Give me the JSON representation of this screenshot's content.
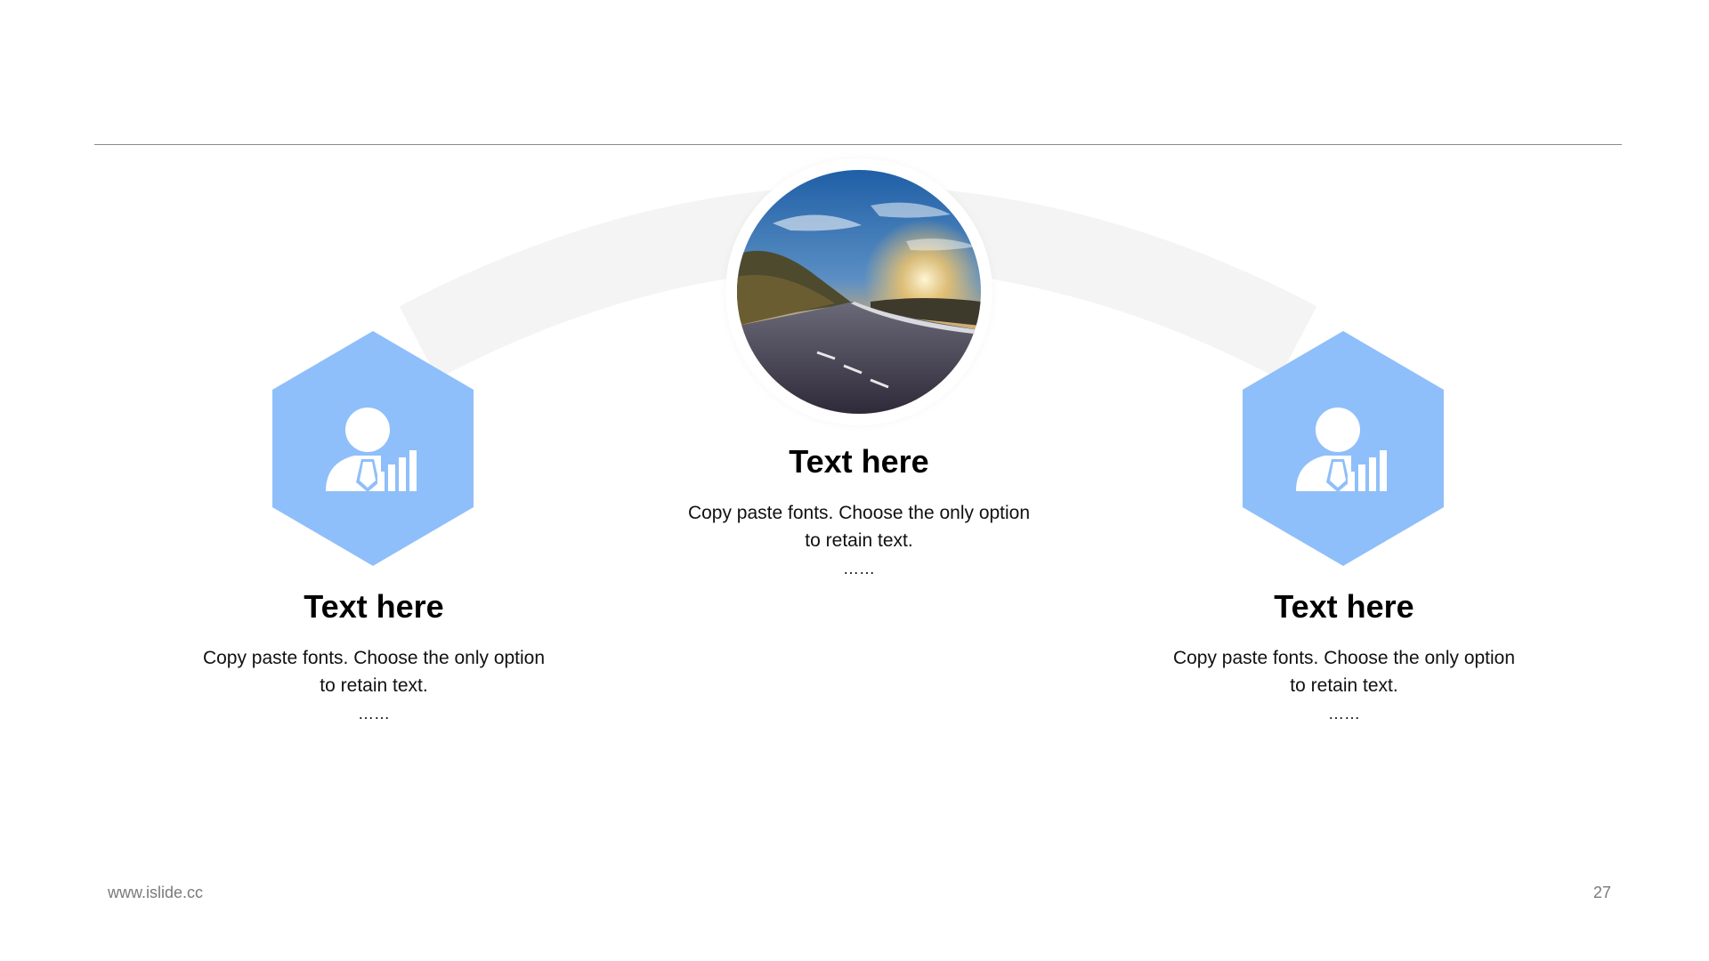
{
  "slide": {
    "accent_color": "#8fbffa",
    "arc_color": "#f4f4f4",
    "items": [
      {
        "heading": "Text here",
        "body_line1": "Copy paste fonts. Choose the only option",
        "body_line2": "to retain text.",
        "ellipsis": "……",
        "icon": "businessman-chart-icon"
      },
      {
        "heading": "Text here",
        "body_line1": "Copy paste fonts. Choose the only option",
        "body_line2": "to retain text.",
        "ellipsis": "……",
        "image": "road-sunset-photo"
      },
      {
        "heading": "Text here",
        "body_line1": "Copy paste fonts. Choose the only option",
        "body_line2": "to retain text.",
        "ellipsis": "……",
        "icon": "businessman-chart-icon"
      }
    ]
  },
  "footer": {
    "url": "www.islide.cc",
    "page_number": "27"
  }
}
